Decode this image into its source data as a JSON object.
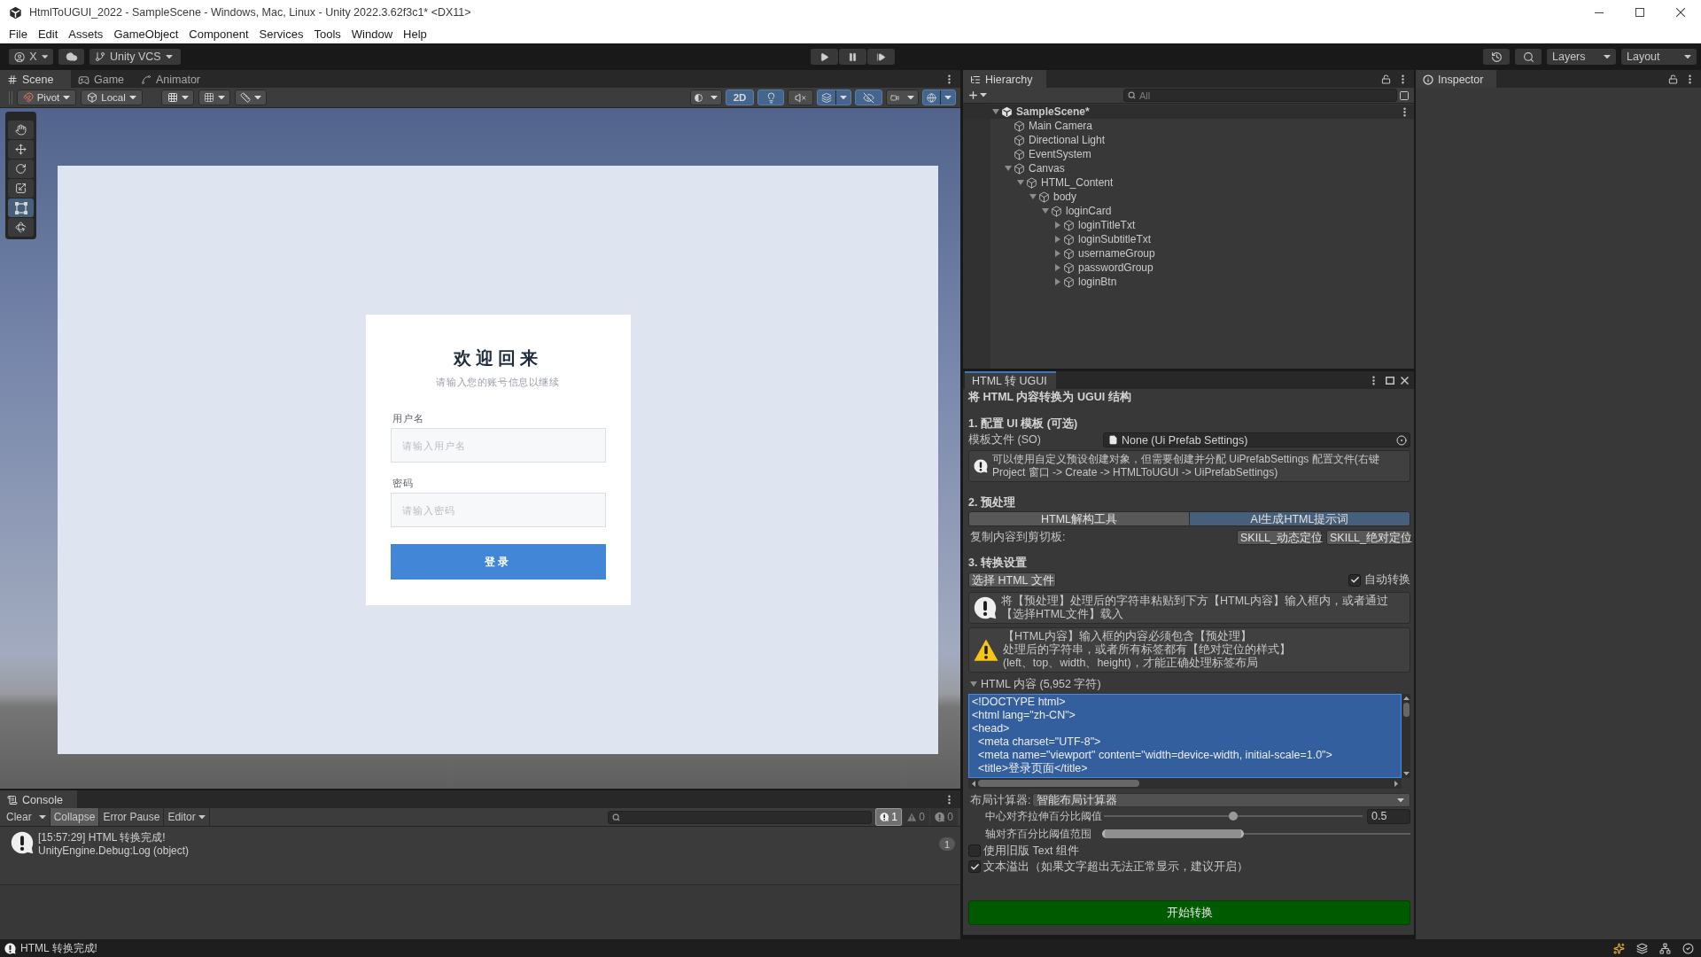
{
  "window": {
    "title": "HtmlToUGUI_2022 - SampleScene - Windows, Mac, Linux - Unity 2022.3.62f3c1* <DX11>"
  },
  "menu": [
    "File",
    "Edit",
    "Assets",
    "GameObject",
    "Component",
    "Services",
    "Tools",
    "Window",
    "Help"
  ],
  "toolbar": {
    "account": "X",
    "version_control": "Unity VCS",
    "layers": "Layers",
    "layout": "Layout"
  },
  "scene_panel": {
    "tabs": [
      {
        "label": "Scene",
        "kind": "scene",
        "selected": true
      },
      {
        "label": "Game",
        "kind": "game",
        "selected": false
      },
      {
        "label": "Animator",
        "kind": "animator",
        "selected": false
      }
    ],
    "pivot": "Pivot",
    "space": "Local",
    "view_options": [
      {
        "kind": "shading",
        "on": false
      },
      {
        "kind": "flat",
        "label": "2D",
        "on": true
      },
      {
        "kind": "lighting",
        "on": true
      },
      {
        "kind": "audio",
        "on": false
      },
      {
        "kind": "effects",
        "on": true
      },
      {
        "kind": "hidden",
        "on": true
      },
      {
        "kind": "camera",
        "on": false
      },
      {
        "kind": "gizmos",
        "on": true
      }
    ],
    "tools": [
      {
        "kind": "hand",
        "selected": false
      },
      {
        "kind": "move",
        "selected": false
      },
      {
        "kind": "rotate",
        "selected": false
      },
      {
        "kind": "scale",
        "selected": false
      },
      {
        "kind": "rect",
        "selected": true
      },
      {
        "kind": "transform",
        "selected": false
      }
    ],
    "login_card": {
      "title": "欢迎回来",
      "subtitle": "请输入您的账号信息以继续",
      "fields": [
        {
          "label": "用户名",
          "placeholder": "请输入用户名"
        },
        {
          "label": "密码",
          "placeholder": "请输入密码"
        }
      ],
      "button": "登录"
    }
  },
  "hierarchy": {
    "tab": "Hierarchy",
    "search": {
      "placeholder": "All"
    },
    "scene": {
      "label": "SampleScene*",
      "expanded": true,
      "children": [
        {
          "label": "Main Camera"
        },
        {
          "label": "Directional Light"
        },
        {
          "label": "EventSystem"
        },
        {
          "label": "Canvas",
          "expanded": true,
          "children": [
            {
              "label": "HTML_Content",
              "expanded": true,
              "children": [
                {
                  "label": "body",
                  "expanded": true,
                  "children": [
                    {
                      "label": "loginCard",
                      "expanded": true,
                      "children": [
                        {
                          "label": "loginTitleTxt",
                          "expanded": false
                        },
                        {
                          "label": "loginSubtitleTxt",
                          "expanded": false
                        },
                        {
                          "label": "usernameGroup",
                          "expanded": false
                        },
                        {
                          "label": "passwordGroup",
                          "expanded": false
                        },
                        {
                          "label": "loginBtn",
                          "expanded": false
                        }
                      ]
                    }
                  ]
                }
              ]
            }
          ]
        }
      ]
    }
  },
  "inspector": {
    "tab": "Inspector"
  },
  "converter": {
    "tab": "HTML 转 UGUI",
    "heading": "将 HTML 内容转换为 UGUI 结构",
    "template": {
      "title": "1. 配置 UI 模板 (可选)",
      "label": "模板文件 (SO)",
      "value": "None (Ui Prefab Settings)",
      "note": "可以使用自定义预设创建对象，但需要创建并分配 UiPrefabSettings 配置文件(右键 Project 窗口 -> Create -> HTMLToUGUI -> UiPrefabSettings)"
    },
    "preprocess": {
      "title": "2. 预处理",
      "tabs": [
        {
          "label": "HTML解构工具",
          "selected": false
        },
        {
          "label": "AI生成HTML提示词",
          "selected": true
        }
      ],
      "copy_label": "复制内容到剪切板:",
      "copy_buttons": [
        "SKILL_动态定位",
        "SKILL_绝对定位"
      ]
    },
    "settings": {
      "title": "3. 转换设置",
      "choose_file": "选择 HTML 文件",
      "auto_convert": {
        "label": "自动转换",
        "checked": true
      },
      "notes": [
        {
          "kind": "info",
          "lines": [
            "将【预处理】处理后的字符串粘贴到下方【HTML内容】输入框内，或者通过",
            "【选择HTML文件】载入"
          ]
        },
        {
          "kind": "warning",
          "lines": [
            "【HTML内容】输入框的内容必须包含【预处理】",
            "处理后的字符串，或者所有标签都有【绝对定位的样式】",
            "(left、top、width、height)，才能正确处理标签布局"
          ]
        }
      ],
      "html_content": {
        "label": "HTML 内容 (5,952 字符)",
        "expanded": true,
        "selected": true,
        "lines": [
          "<!DOCTYPE html>",
          "<html lang=\"zh-CN\">",
          "<head>",
          "  <meta charset=\"UTF-8\">",
          "  <meta name=\"viewport\" content=\"width=device-width, initial-scale=1.0\">",
          "  <title>登录页面</title>"
        ]
      },
      "layout_calculator": {
        "label": "布局计算器:",
        "value": "智能布局计算器"
      },
      "sliders": [
        {
          "kind": "point",
          "label": "中心对齐拉伸百分比阈值",
          "level": 0.5,
          "reading": "0.5"
        },
        {
          "kind": "range",
          "label": "轴对齐百分比阈值范围",
          "level": 0.46
        }
      ],
      "options": [
        {
          "label": "使用旧版 Text 组件",
          "checked": false
        },
        {
          "label": "文本溢出（如果文字超出无法正常显示，建议开启）",
          "checked": true
        }
      ]
    },
    "convert_button": "开始转换"
  },
  "console": {
    "tab": "Console",
    "clear": "Clear",
    "collapse": {
      "label": "Collapse",
      "on": true
    },
    "error_pause": {
      "label": "Error Pause",
      "on": false
    },
    "editor": "Editor",
    "filters": [
      {
        "kind": "info",
        "count": "1",
        "on": true
      },
      {
        "kind": "warning",
        "count": "0",
        "on": false
      },
      {
        "kind": "error",
        "count": "0",
        "on": false
      }
    ],
    "entries": [
      {
        "kind": "info",
        "message": "[15:57:29] HTML 转换完成!",
        "trace": "UnityEngine.Debug:Log (object)",
        "count": "1"
      }
    ]
  },
  "status_bar": {
    "message": "HTML 转换完成!"
  }
}
